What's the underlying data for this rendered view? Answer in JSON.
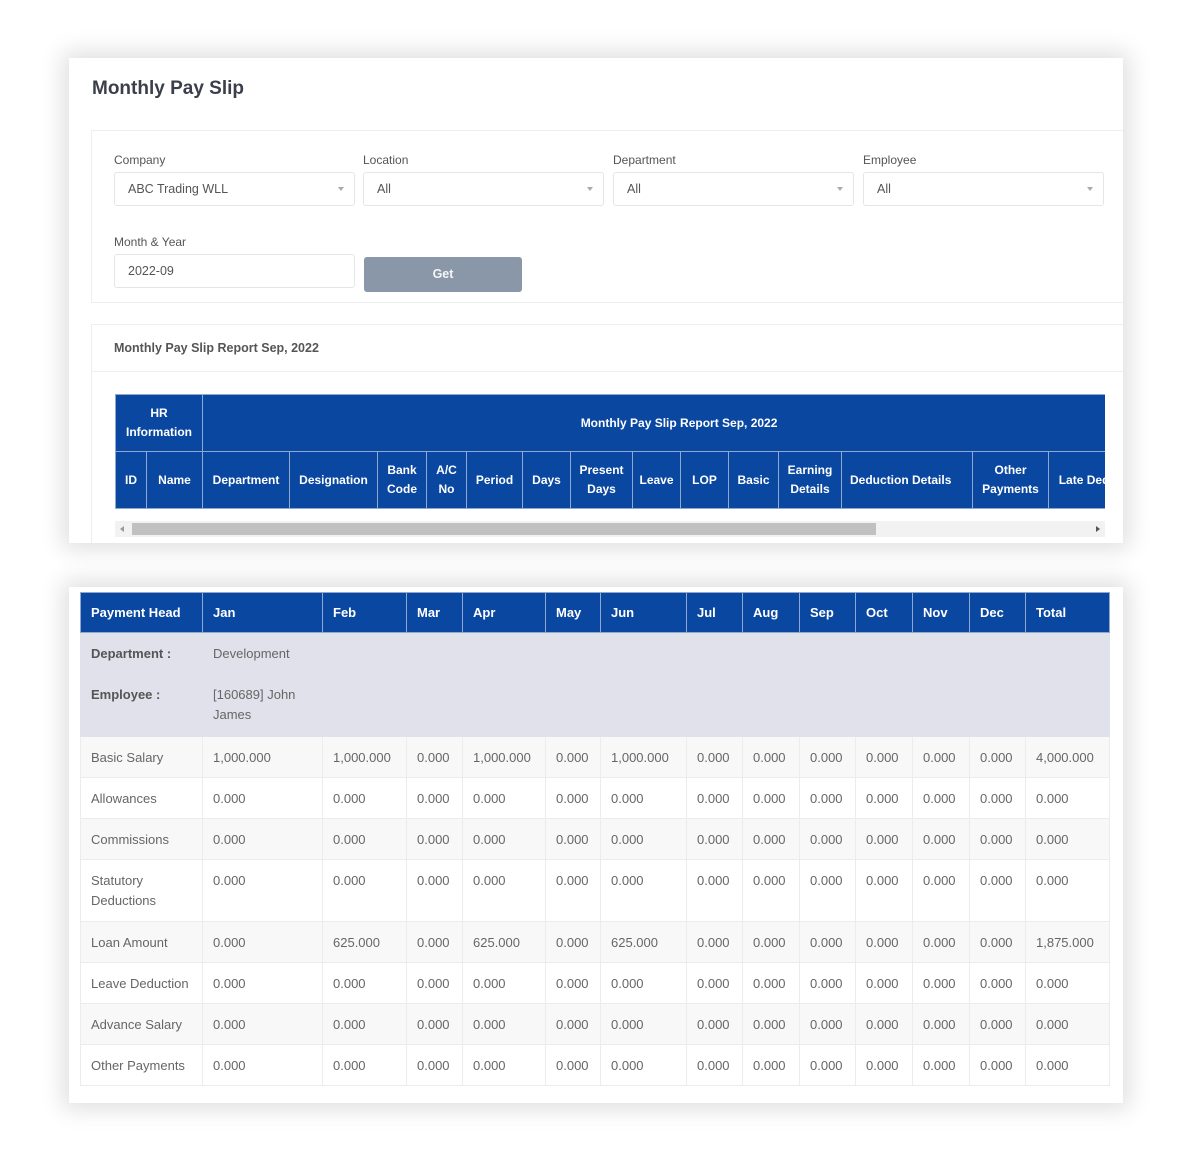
{
  "page_title": "Monthly Pay Slip",
  "filters": {
    "company": {
      "label": "Company",
      "value": "ABC Trading WLL"
    },
    "location": {
      "label": "Location",
      "value": "All"
    },
    "department": {
      "label": "Department",
      "value": "All"
    },
    "employee": {
      "label": "Employee",
      "value": "All"
    },
    "month_year": {
      "label": "Month & Year",
      "value": "2022-09"
    },
    "get_button": "Get"
  },
  "report": {
    "title": "Monthly Pay Slip Report Sep, 2022",
    "group_headers": [
      "HR Information",
      "Monthly Pay Slip Report Sep, 2022"
    ],
    "columns": [
      "ID",
      "Name",
      "Department",
      "Designation",
      "Bank Code",
      "A/C No",
      "Period",
      "Days",
      "Present Days",
      "Leave",
      "LOP",
      "Basic",
      "Earning Details",
      "Deduction Details",
      "Other Payments",
      "Late Deductions"
    ]
  },
  "pay_table": {
    "headers": [
      "Payment Head",
      "Jan",
      "Feb",
      "Mar",
      "Apr",
      "May",
      "Jun",
      "Jul",
      "Aug",
      "Sep",
      "Oct",
      "Nov",
      "Dec",
      "Total"
    ],
    "department": {
      "label": "Department :",
      "value": "Development"
    },
    "employee": {
      "label": "Employee :",
      "value": "[160689] John James"
    },
    "rows": [
      {
        "head": "Basic Salary",
        "values": [
          "1,000.000",
          "1,000.000",
          "0.000",
          "1,000.000",
          "0.000",
          "1,000.000",
          "0.000",
          "0.000",
          "0.000",
          "0.000",
          "0.000",
          "0.000",
          "4,000.000"
        ]
      },
      {
        "head": "Allowances",
        "values": [
          "0.000",
          "0.000",
          "0.000",
          "0.000",
          "0.000",
          "0.000",
          "0.000",
          "0.000",
          "0.000",
          "0.000",
          "0.000",
          "0.000",
          "0.000"
        ]
      },
      {
        "head": "Commissions",
        "values": [
          "0.000",
          "0.000",
          "0.000",
          "0.000",
          "0.000",
          "0.000",
          "0.000",
          "0.000",
          "0.000",
          "0.000",
          "0.000",
          "0.000",
          "0.000"
        ]
      },
      {
        "head": "Statutory Deductions",
        "values": [
          "0.000",
          "0.000",
          "0.000",
          "0.000",
          "0.000",
          "0.000",
          "0.000",
          "0.000",
          "0.000",
          "0.000",
          "0.000",
          "0.000",
          "0.000"
        ]
      },
      {
        "head": "Loan Amount",
        "values": [
          "0.000",
          "625.000",
          "0.000",
          "625.000",
          "0.000",
          "625.000",
          "0.000",
          "0.000",
          "0.000",
          "0.000",
          "0.000",
          "0.000",
          "1,875.000"
        ]
      },
      {
        "head": "Leave Deduction",
        "values": [
          "0.000",
          "0.000",
          "0.000",
          "0.000",
          "0.000",
          "0.000",
          "0.000",
          "0.000",
          "0.000",
          "0.000",
          "0.000",
          "0.000",
          "0.000"
        ]
      },
      {
        "head": "Advance Salary",
        "values": [
          "0.000",
          "0.000",
          "0.000",
          "0.000",
          "0.000",
          "0.000",
          "0.000",
          "0.000",
          "0.000",
          "0.000",
          "0.000",
          "0.000",
          "0.000"
        ]
      },
      {
        "head": "Other Payments",
        "values": [
          "0.000",
          "0.000",
          "0.000",
          "0.000",
          "0.000",
          "0.000",
          "0.000",
          "0.000",
          "0.000",
          "0.000",
          "0.000",
          "0.000",
          "0.000"
        ]
      }
    ]
  }
}
